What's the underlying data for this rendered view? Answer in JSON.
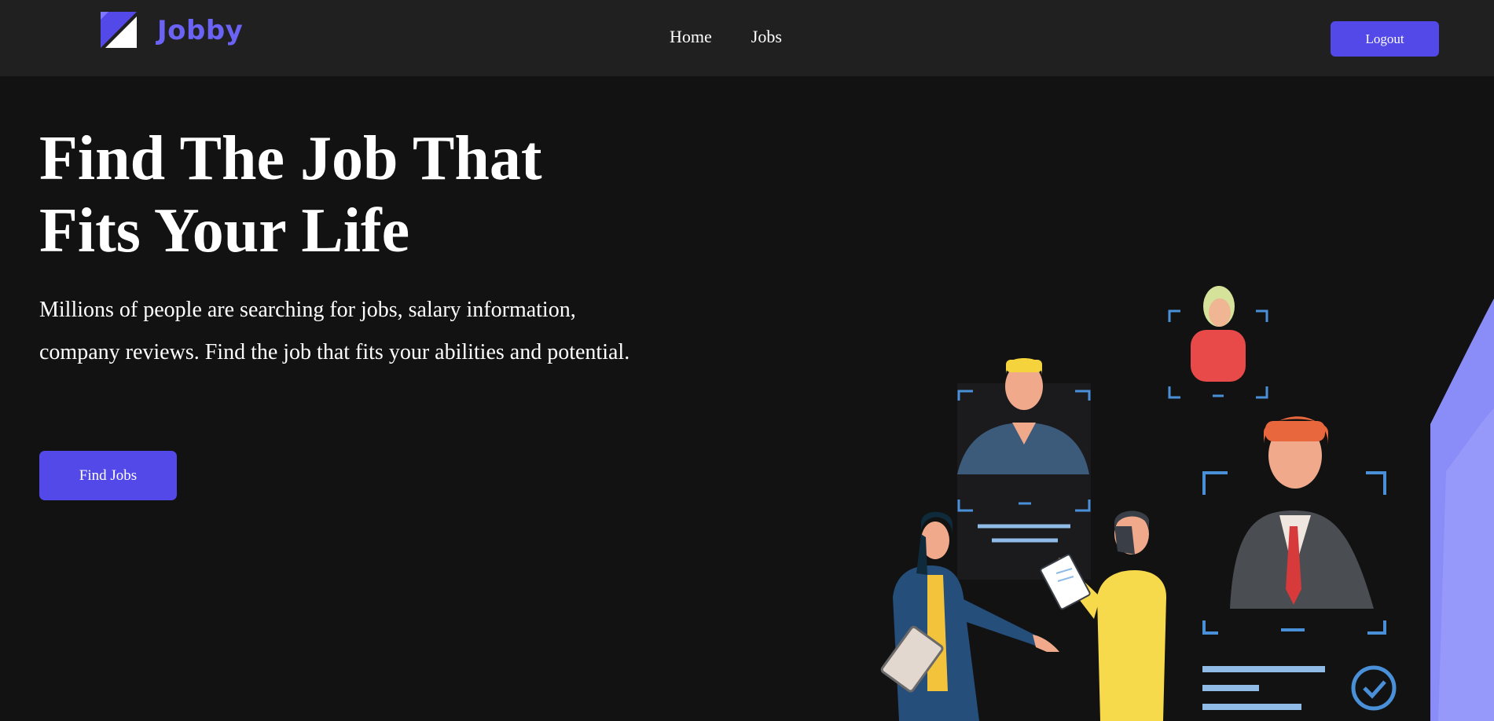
{
  "brand": {
    "name": "Jobby",
    "icon": "logo-mark-icon",
    "color": "#6b63f5"
  },
  "nav": {
    "links": [
      "Home",
      "Jobs"
    ]
  },
  "header": {
    "logout_label": "Logout"
  },
  "hero": {
    "title_line1": "Find The Job That",
    "title_line2": "Fits Your Life",
    "description": "Millions of people are searching for jobs, salary information, company reviews. Find the job that fits your abilities and potential.",
    "cta_label": "Find Jobs"
  },
  "colors": {
    "accent": "#5249e8",
    "background": "#121212",
    "navbar": "#202020"
  }
}
